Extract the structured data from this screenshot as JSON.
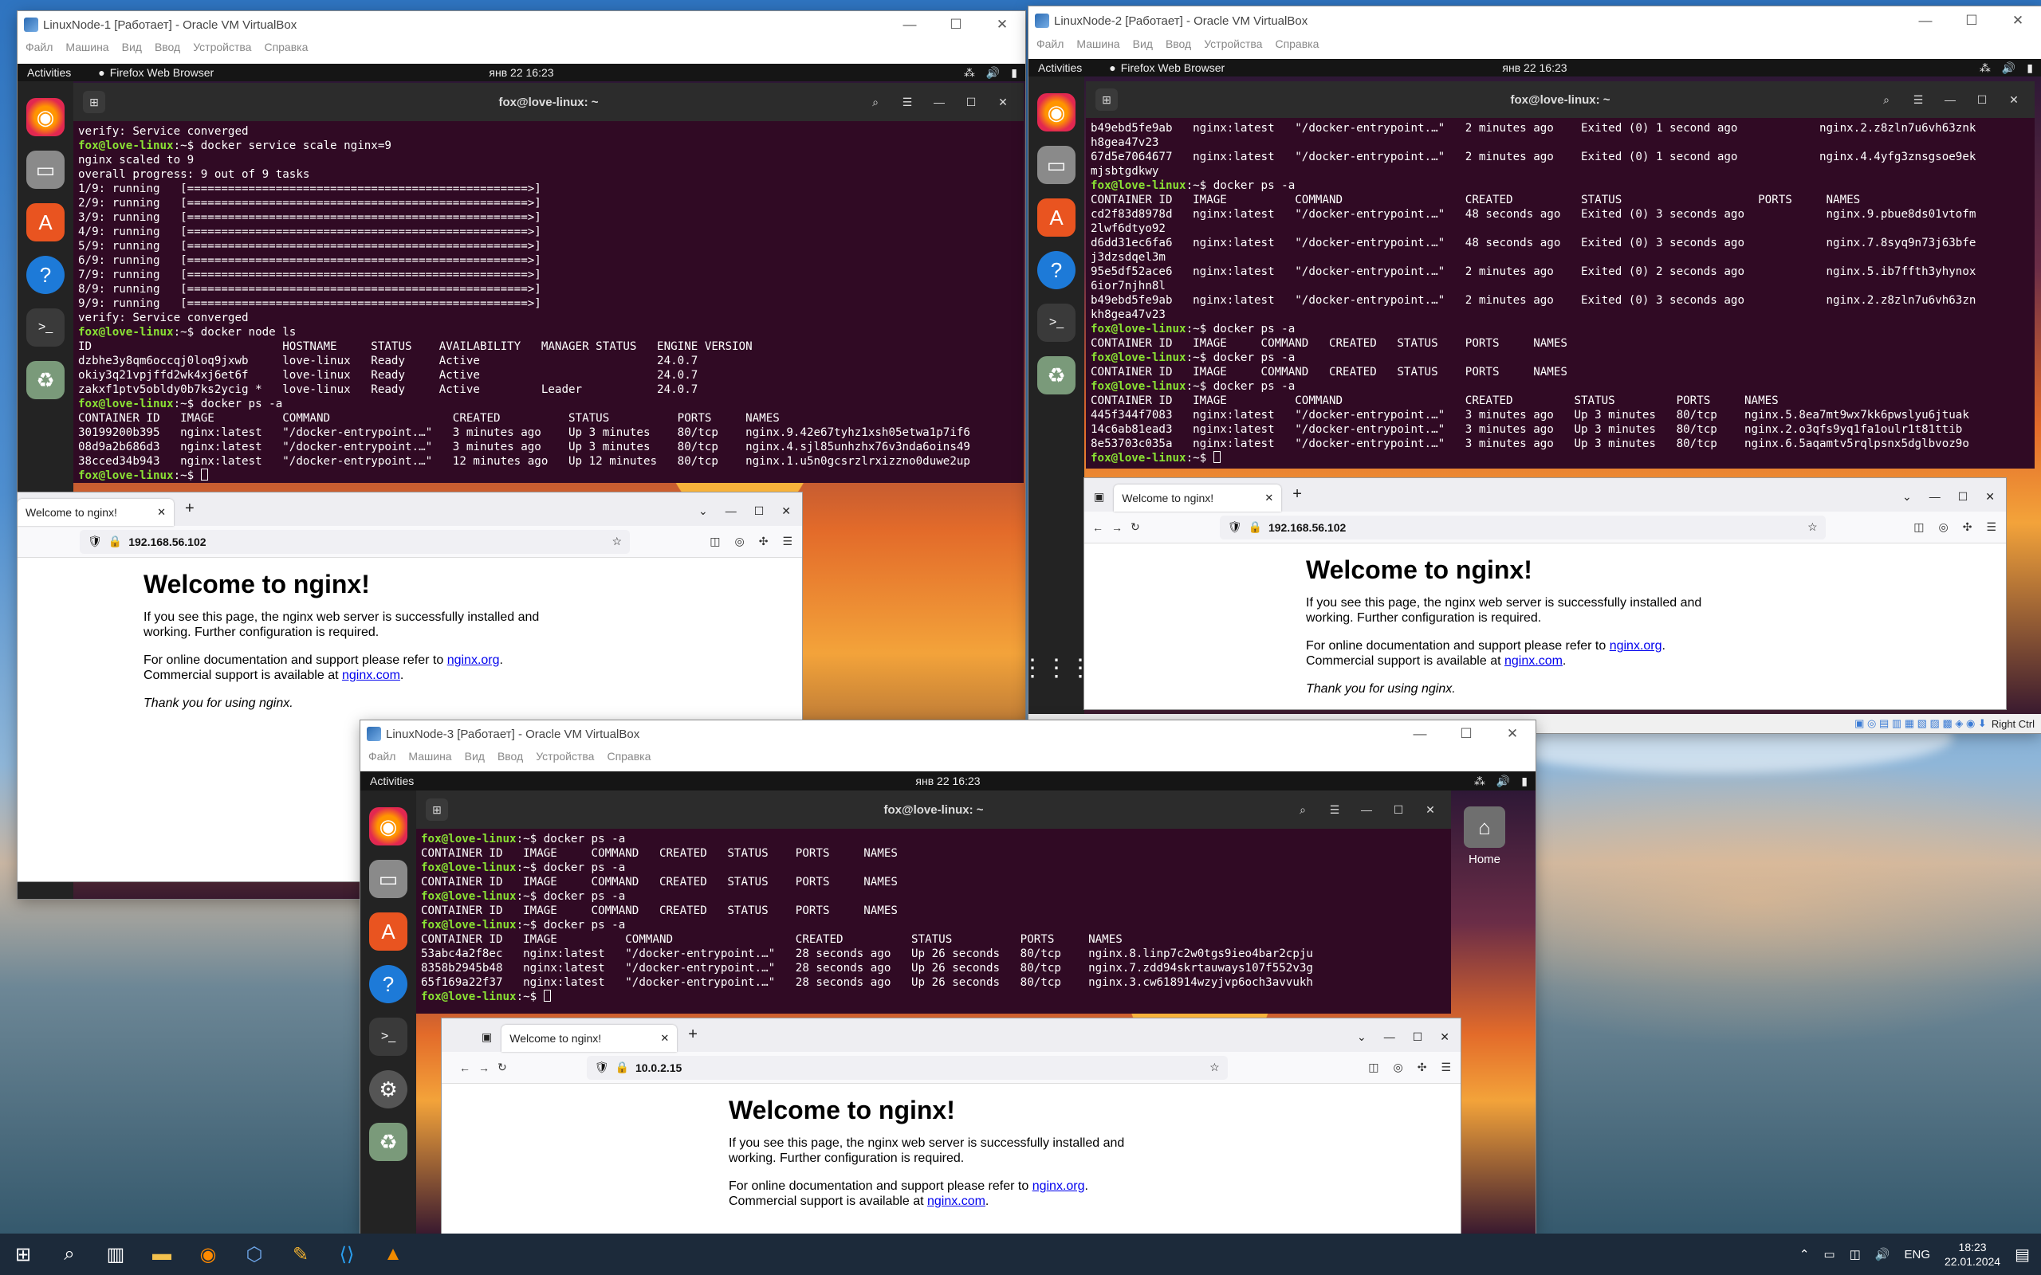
{
  "vm1": {
    "title": "LinuxNode-1 [Работает] - Oracle VM VirtualBox",
    "menu": [
      "Файл",
      "Машина",
      "Вид",
      "Ввод",
      "Устройства",
      "Справка"
    ]
  },
  "vm2": {
    "title": "LinuxNode-2 [Работает] - Oracle VM VirtualBox",
    "menu": [
      "Файл",
      "Машина",
      "Вид",
      "Ввод",
      "Устройства",
      "Справка"
    ],
    "statusbar": "Right Ctrl"
  },
  "vm3": {
    "title": "LinuxNode-3 [Работает] - Oracle VM VirtualBox",
    "menu": [
      "Файл",
      "Машина",
      "Вид",
      "Ввод",
      "Устройства",
      "Справка"
    ]
  },
  "gnome": {
    "activities": "Activities",
    "app": "Firefox Web Browser",
    "clock": "янв 22  16:23",
    "home": "Home"
  },
  "term": {
    "title": "fox@love-linux: ~",
    "prompt": "fox@love-linux:~$ "
  },
  "t1": [
    "verify: Service converged",
    "§docker service scale nginx=9",
    "nginx scaled to 9",
    "overall progress: 9 out of 9 tasks",
    "1/9: running   [==================================================>]",
    "2/9: running   [==================================================>]",
    "3/9: running   [==================================================>]",
    "4/9: running   [==================================================>]",
    "5/9: running   [==================================================>]",
    "6/9: running   [==================================================>]",
    "7/9: running   [==================================================>]",
    "8/9: running   [==================================================>]",
    "9/9: running   [==================================================>]",
    "verify: Service converged",
    "§docker node ls",
    "ID                            HOSTNAME     STATUS    AVAILABILITY   MANAGER STATUS   ENGINE VERSION",
    "dzbhe3y8qm6occqj0loq9jxwb     love-linux   Ready     Active                          24.0.7",
    "okiy3q21vpjffd2wk4xj6et6f     love-linux   Ready     Active                          24.0.7",
    "zakxf1ptv5obldy0b7ks2ycig *   love-linux   Ready     Active         Leader           24.0.7",
    "§docker ps -a",
    "CONTAINER ID   IMAGE          COMMAND                  CREATED          STATUS          PORTS     NAMES",
    "30199200b395   nginx:latest   \"/docker-entrypoint.…\"   3 minutes ago    Up 3 minutes    80/tcp    nginx.9.42e67tyhz1xsh05etwa1p7if6",
    "08d9a2b686d3   nginx:latest   \"/docker-entrypoint.…\"   3 minutes ago    Up 3 minutes    80/tcp    nginx.4.sjl85unhzhx76v3nda6oins49",
    "38cced34b943   nginx:latest   \"/docker-entrypoint.…\"   12 minutes ago   Up 12 minutes   80/tcp    nginx.1.u5n0gcsrzlrxizzno0duwe2up",
    "§"
  ],
  "t2": [
    "b49ebd5fe9ab   nginx:latest   \"/docker-entrypoint.…\"   2 minutes ago    Exited (0) 1 second ago            nginx.2.z8zln7u6vh63znk",
    "h8gea47v23",
    "67d5e7064677   nginx:latest   \"/docker-entrypoint.…\"   2 minutes ago    Exited (0) 1 second ago            nginx.4.4yfg3znsgsoe9ek",
    "mjsbtgdkwy",
    "§docker ps -a",
    "CONTAINER ID   IMAGE          COMMAND                  CREATED          STATUS                    PORTS     NAMES",
    "cd2f83d8978d   nginx:latest   \"/docker-entrypoint.…\"   48 seconds ago   Exited (0) 3 seconds ago            nginx.9.pbue8ds01vtofm",
    "2lwf6dtyo92",
    "d6dd31ec6fa6   nginx:latest   \"/docker-entrypoint.…\"   48 seconds ago   Exited (0) 3 seconds ago            nginx.7.8syq9n73j63bfe",
    "j3dzsdqel3m",
    "95e5df52ace6   nginx:latest   \"/docker-entrypoint.…\"   2 minutes ago    Exited (0) 2 seconds ago            nginx.5.ib7ffth3yhynox",
    "6ior7njhn8l",
    "b49ebd5fe9ab   nginx:latest   \"/docker-entrypoint.…\"   2 minutes ago    Exited (0) 3 seconds ago            nginx.2.z8zln7u6vh63zn",
    "kh8gea47v23",
    "§docker ps -a",
    "CONTAINER ID   IMAGE     COMMAND   CREATED   STATUS    PORTS     NAMES",
    "§docker ps -a",
    "CONTAINER ID   IMAGE     COMMAND   CREATED   STATUS    PORTS     NAMES",
    "§docker ps -a",
    "CONTAINER ID   IMAGE          COMMAND                  CREATED         STATUS         PORTS     NAMES",
    "445f344f7083   nginx:latest   \"/docker-entrypoint.…\"   3 minutes ago   Up 3 minutes   80/tcp    nginx.5.8ea7mt9wx7kk6pwslyu6jtuak",
    "14c6ab81ead3   nginx:latest   \"/docker-entrypoint.…\"   3 minutes ago   Up 3 minutes   80/tcp    nginx.2.o3qfs9yq1fa1oulr1t81ttib",
    "8e53703c035a   nginx:latest   \"/docker-entrypoint.…\"   3 minutes ago   Up 3 minutes   80/tcp    nginx.6.5aqamtv5rqlpsnx5dglbvoz9o",
    "§"
  ],
  "t3": [
    "§docker ps -a",
    "CONTAINER ID   IMAGE     COMMAND   CREATED   STATUS    PORTS     NAMES",
    "§docker ps -a",
    "CONTAINER ID   IMAGE     COMMAND   CREATED   STATUS    PORTS     NAMES",
    "§docker ps -a",
    "CONTAINER ID   IMAGE     COMMAND   CREATED   STATUS    PORTS     NAMES",
    "§docker ps -a",
    "CONTAINER ID   IMAGE          COMMAND                  CREATED          STATUS          PORTS     NAMES",
    "53abc4a2f8ec   nginx:latest   \"/docker-entrypoint.…\"   28 seconds ago   Up 26 seconds   80/tcp    nginx.8.linp7c2w0tgs9ieo4bar2cpju",
    "8358b2945b48   nginx:latest   \"/docker-entrypoint.…\"   28 seconds ago   Up 26 seconds   80/tcp    nginx.7.zdd94skrtauways107f552v3g",
    "65f169a22f37   nginx:latest   \"/docker-entrypoint.…\"   28 seconds ago   Up 26 seconds   80/tcp    nginx.3.cw618914wzyjvp6och3avvukh",
    "§"
  ],
  "ff1": {
    "tab": "Welcome to nginx!",
    "url": "192.168.56.102"
  },
  "ff2": {
    "tab": "Welcome to nginx!",
    "url": "192.168.56.102"
  },
  "ff3": {
    "tab": "Welcome to nginx!",
    "url": "10.0.2.15"
  },
  "nginx": {
    "h1": "Welcome to nginx!",
    "p1": "If you see this page, the nginx web server is successfully installed and working. Further configuration is required.",
    "p2a": "For online documentation and support please refer to ",
    "link1": "nginx.org",
    "p2b": ".",
    "p2c": "Commercial support is available at ",
    "link2": "nginx.com",
    "p2d": ".",
    "p3": "Thank you for using nginx."
  },
  "taskbar": {
    "lang": "ENG",
    "time": "18:23",
    "date": "22.01.2024"
  },
  "icons": [
    "windows-start-icon",
    "search-icon",
    "task-view-icon",
    "file-explorer-icon",
    "firefox-icon",
    "virtualbox-icon",
    "tools-icon",
    "vscode-icon",
    "vlc-icon"
  ]
}
